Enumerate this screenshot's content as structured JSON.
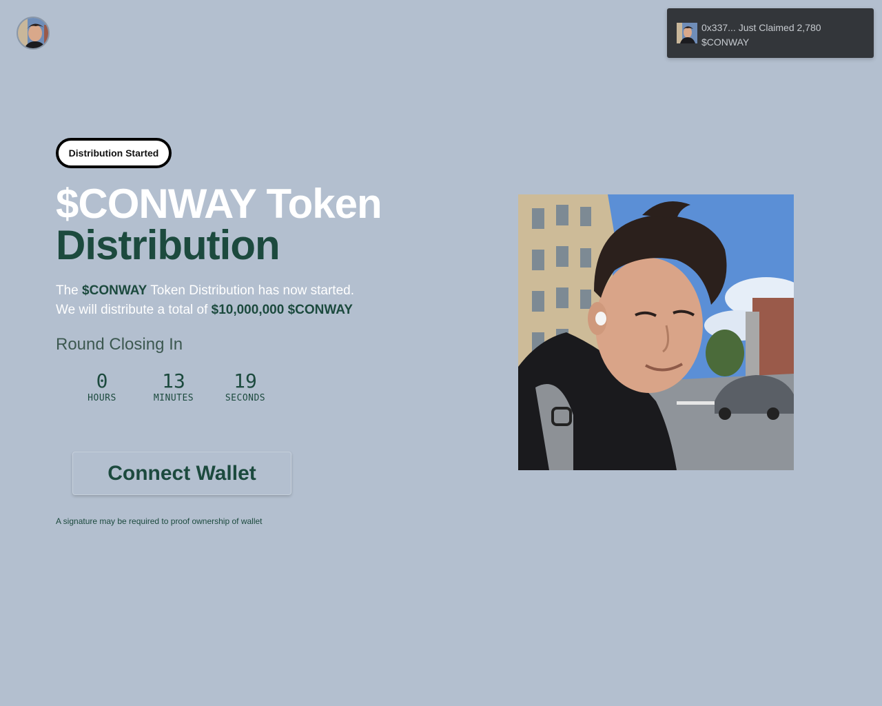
{
  "header": {
    "avatar_name": "profile-avatar"
  },
  "toast": {
    "message_line1": "0x337... Just Claimed 2,780",
    "message_line2": "$CONWAY"
  },
  "badge": {
    "label": "Distribution Started"
  },
  "hero": {
    "title_line1": "$CONWAY Token",
    "title_line2": "Distribution",
    "desc_prefix": "The ",
    "desc_token": "$CONWAY",
    "desc_suffix": " Token Distribution has now started.",
    "desc_line2_prefix": "We will distribute a total of ",
    "desc_line2_amount": "$10,000,000 $CONWAY"
  },
  "countdown": {
    "label": "Round Closing In",
    "units": [
      {
        "value": "0",
        "label": "HOURS"
      },
      {
        "value": "13",
        "label": "MINUTES"
      },
      {
        "value": "19",
        "label": "SECONDS"
      }
    ]
  },
  "cta": {
    "label": "Connect Wallet"
  },
  "note": "A signature may be required to proof ownership of wallet",
  "colors": {
    "background": "#b3bfcf",
    "accent": "#1c4a3e",
    "toast_bg": "#33363a"
  }
}
